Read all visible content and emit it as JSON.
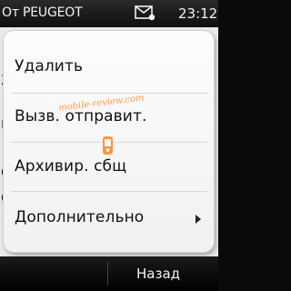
{
  "status": {
    "title": "От PEUGEOT",
    "time": "23:12",
    "icon": "message-envelope-icon"
  },
  "watermark": "mobile-review.com",
  "menu": {
    "items": [
      {
        "label": "Удалить",
        "has_submenu": false
      },
      {
        "label": "Вызв. отправит.",
        "has_submenu": false
      },
      {
        "label": "Архивир. сбщ",
        "has_submenu": false
      },
      {
        "label": "Дополнительно",
        "has_submenu": true
      }
    ]
  },
  "softkeys": {
    "right": "Назад"
  },
  "colors": {
    "accent": "#ff8c2a",
    "popup_background": "#f6f6f6",
    "bar_background": "#111111"
  }
}
